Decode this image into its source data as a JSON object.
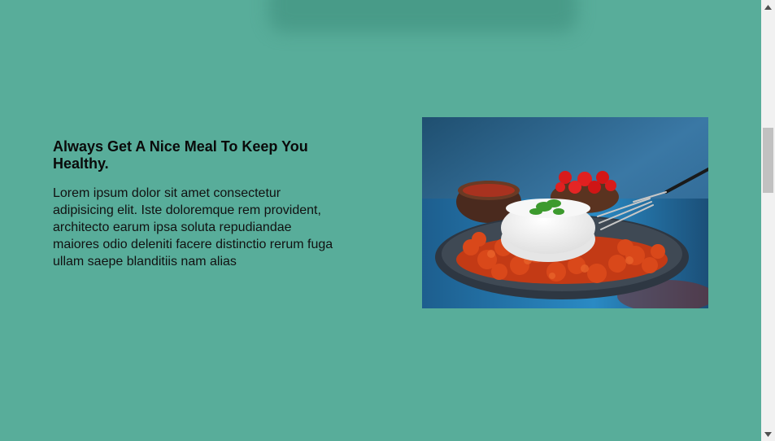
{
  "feature": {
    "heading": "Always Get A Nice Meal To Keep You Healthy.",
    "body": "Lorem ipsum dolor sit amet consectetur adipisicing elit. Iste doloremque rem provident, architecto earum ipsa soluta repudiandae maiores odio deleniti facere distinctio rerum fuga ullam saepe blanditiis nam alias"
  },
  "colors": {
    "background": "#58ad9a",
    "text": "#0a0a0a"
  },
  "icons": {
    "scroll_up": "scroll-up-arrow-icon",
    "scroll_down": "scroll-down-arrow-icon"
  }
}
